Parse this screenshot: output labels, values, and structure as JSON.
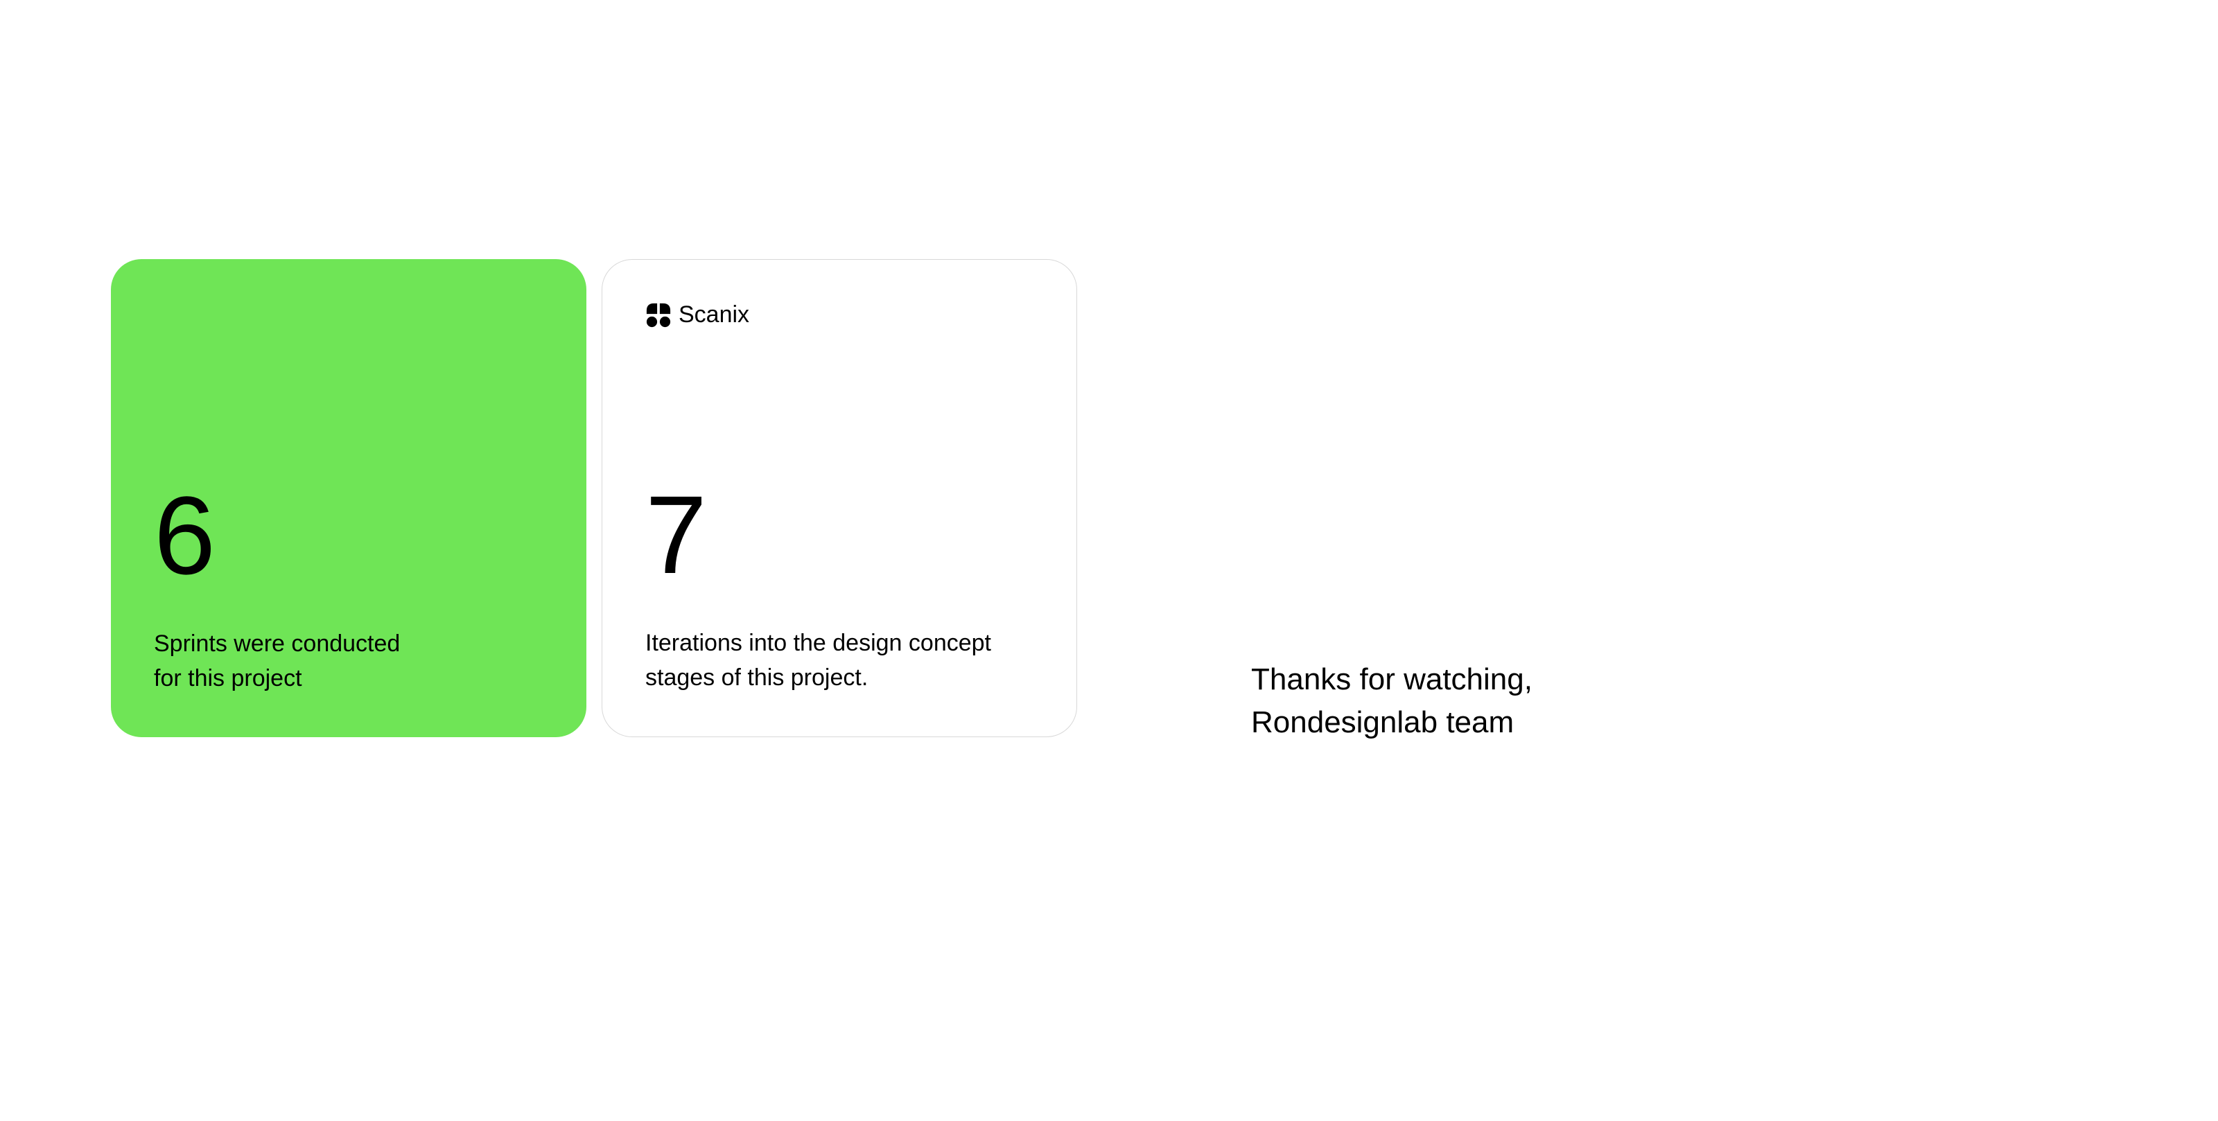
{
  "cards": [
    {
      "number": "6",
      "description": "Sprints were conducted\nfor this project"
    },
    {
      "brand": "Scanix",
      "number": "7",
      "description": "Iterations into the design concept\nstages of this project."
    }
  ],
  "thanks": "Thanks for watching,\nRondesignlab team"
}
